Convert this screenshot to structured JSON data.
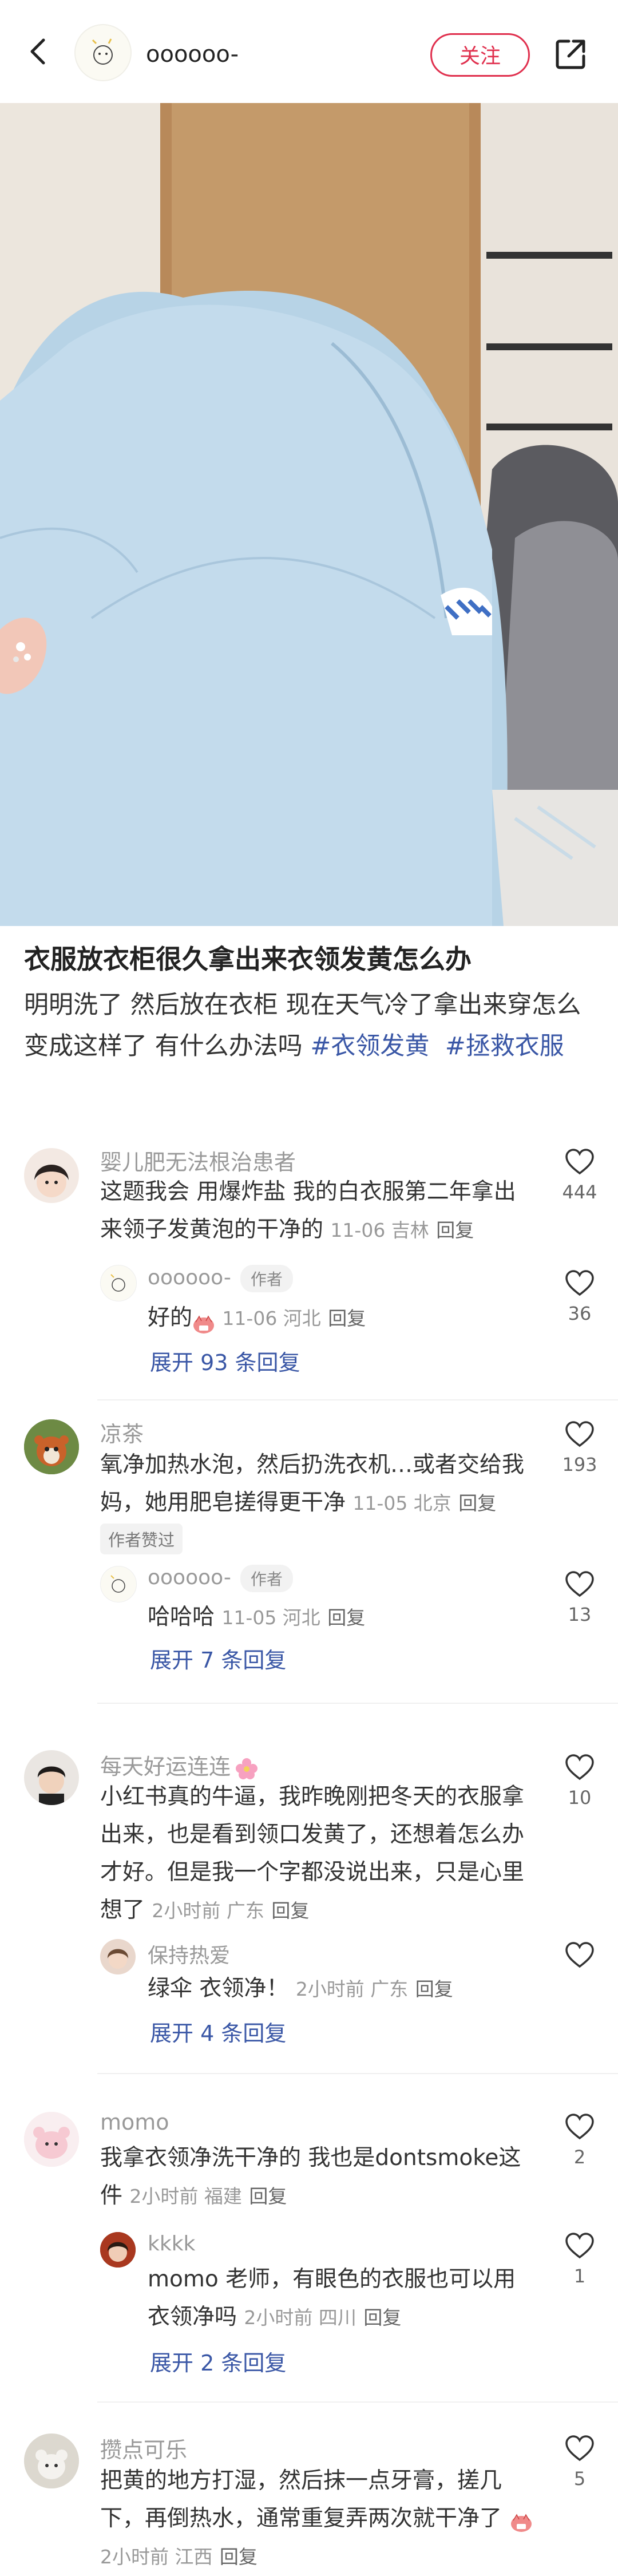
{
  "header": {
    "author_name": "oooooo-",
    "follow_label": "关注"
  },
  "post": {
    "title": "衣服放衣柜很久拿出来衣领发黄怎么办",
    "body": "明明洗了 然后放在衣柜 现在天气冷了拿出来穿怎么变成这样了 有什么办法吗",
    "tags": [
      "#衣领发黄",
      "#拯救衣服"
    ]
  },
  "comments": [
    {
      "name": "婴儿肥无法根治患者",
      "text": "这题我会 用爆炸盐 我的白衣服第二年拿出来领子发黄泡的干净的",
      "meta": "11-06 吉林",
      "reply_label": "回复",
      "likes": "444",
      "reply": {
        "name": "oooooo-",
        "badge": "作者",
        "text": "好的",
        "meta": "11-06 河北",
        "reply_label": "回复",
        "likes": "36"
      },
      "expand": "展开 93 条回复"
    },
    {
      "name": "凉茶",
      "text": "氧净加热水泡，然后扔洗衣机…或者交给我妈，她用肥皂搓得更干净",
      "meta": "11-05 北京",
      "reply_label": "回复",
      "likes": "193",
      "author_praised": "作者赞过",
      "reply": {
        "name": "oooooo-",
        "badge": "作者",
        "text": "哈哈哈",
        "meta": "11-05 河北",
        "reply_label": "回复",
        "likes": "13"
      },
      "expand": "展开 7 条回复"
    },
    {
      "name": "每天好运连连",
      "text": "小红书真的牛逼，我昨晚刚把冬天的衣服拿出来，也是看到领口发黄了，还想着怎么办才好。但是我一个字都没说出来，只是心里想了",
      "meta": "2小时前 广东",
      "reply_label": "回复",
      "likes": "10",
      "reply": {
        "name": "保持热爱",
        "text": "绿伞 衣领净！",
        "meta": "2小时前 广东",
        "reply_label": "回复",
        "likes": ""
      },
      "expand": "展开 4 条回复"
    },
    {
      "name": "momo",
      "text": "我拿衣领净洗干净的 我也是dontsmoke这件",
      "meta": "2小时前 福建",
      "reply_label": "回复",
      "likes": "2",
      "reply": {
        "name": "kkkk",
        "text": "momo 老师，有眼色的衣服也可以用衣领净吗",
        "meta": "2小时前 四川",
        "reply_label": "回复",
        "likes": "1"
      },
      "expand": "展开 2 条回复"
    },
    {
      "name": "攒点可乐",
      "text": "把黄的地方打湿，然后抹一点牙膏，搓几下，再倒热水，通常重复弄两次就干净了",
      "meta": "2小时前 江西",
      "reply_label": "回复",
      "likes": "5"
    }
  ],
  "colors": {
    "accent": "#e0304e",
    "link": "#3a57a6"
  }
}
